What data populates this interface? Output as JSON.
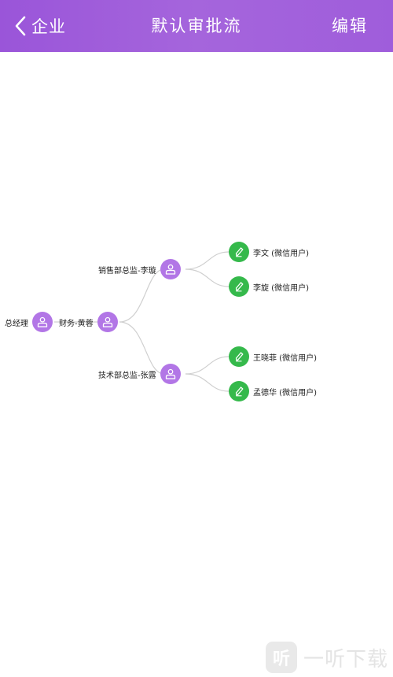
{
  "header": {
    "back_label": "企业",
    "title": "默认审批流",
    "edit_label": "编辑"
  },
  "tree": {
    "root": {
      "label": "总经理",
      "icon": "user-icon",
      "color": "#b276e6"
    },
    "finance": {
      "label": "财务-黄蓉",
      "icon": "user-icon",
      "color": "#b276e6"
    },
    "sales": {
      "label": "销售部总监-李璇",
      "icon": "user-icon",
      "color": "#b276e6",
      "children": [
        {
          "label": "李文 (微信用户)",
          "icon": "pencil-icon",
          "color": "#35b94b"
        },
        {
          "label": "李旋 (微信用户)",
          "icon": "pencil-icon",
          "color": "#35b94b"
        }
      ]
    },
    "tech": {
      "label": "技术部总监-张露",
      "icon": "user-icon",
      "color": "#b276e6",
      "children": [
        {
          "label": "王晓菲 (微信用户)",
          "icon": "pencil-icon",
          "color": "#35b94b"
        },
        {
          "label": "孟德华 (微信用户)",
          "icon": "pencil-icon",
          "color": "#35b94b"
        }
      ]
    }
  },
  "watermark": {
    "icon_text": "听",
    "text": "一听下载"
  },
  "colors": {
    "header_gradient_start": "#9a55d9",
    "header_gradient_end": "#a565dc",
    "purple_node": "#b276e6",
    "green_node": "#35b94b",
    "link_line": "#cfcfcf"
  }
}
